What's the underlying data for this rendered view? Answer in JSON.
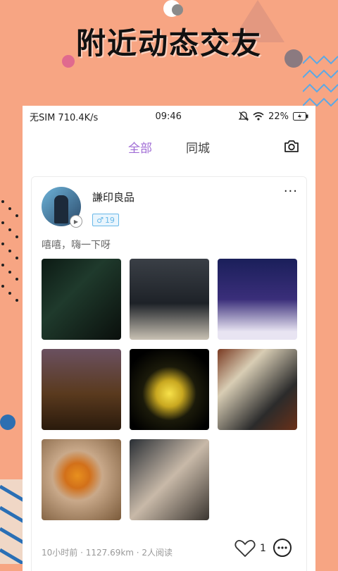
{
  "headline": "附近动态交友",
  "status_bar": {
    "left": "无SIM 710.4K/s",
    "time": "09:46",
    "battery": "22%"
  },
  "tabs": [
    {
      "label": "全部",
      "active": true
    },
    {
      "label": "同城",
      "active": false
    }
  ],
  "post": {
    "username": "謙印良品",
    "age_badge": "19",
    "text": "嘻嘻，嗨一下呀",
    "images": [
      {
        "name": "image-bar-sign"
      },
      {
        "name": "image-man-at-table"
      },
      {
        "name": "image-screenshot-game"
      },
      {
        "name": "image-drink-on-table"
      },
      {
        "name": "image-mix-lamp"
      },
      {
        "name": "image-coffee-sign"
      },
      {
        "name": "image-pastry"
      },
      {
        "name": "image-couple-figurine"
      }
    ],
    "meta": "10小时前 · 1127.69km · 2人阅读",
    "likes": "1"
  },
  "colors": {
    "background": "#f7a583",
    "accent": "#a06cd5",
    "badge": "#68b8e8"
  }
}
